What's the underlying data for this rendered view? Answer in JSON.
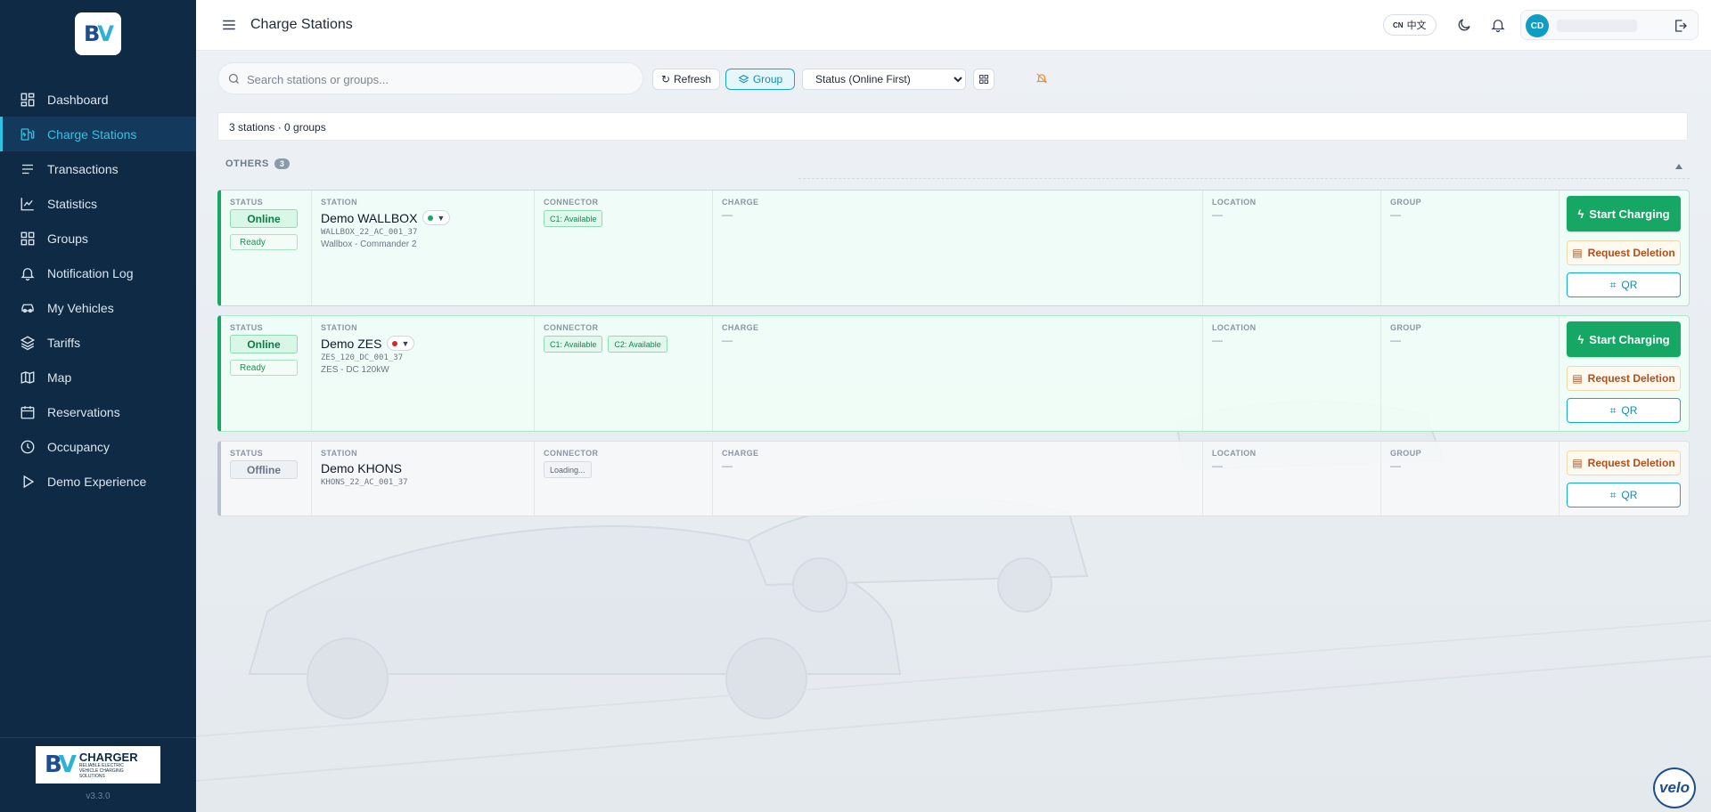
{
  "app": {
    "logo_text": "BV",
    "version": "v3.3.0",
    "brand_title": "CHARGER",
    "brand_subtitle": "RELIABLE ELECTRIC VEHICLE CHARGING SOLUTIONS"
  },
  "sidebar": {
    "items": [
      {
        "label": "Dashboard",
        "icon": "dashboard-icon"
      },
      {
        "label": "Charge Stations",
        "icon": "charger-icon",
        "active": true
      },
      {
        "label": "Transactions",
        "icon": "list-icon"
      },
      {
        "label": "Statistics",
        "icon": "chart-icon"
      },
      {
        "label": "Groups",
        "icon": "grid-icon"
      },
      {
        "label": "Notification Log",
        "icon": "bell-icon"
      },
      {
        "label": "My Vehicles",
        "icon": "car-icon"
      },
      {
        "label": "Tariffs",
        "icon": "layers-icon"
      },
      {
        "label": "Map",
        "icon": "map-icon"
      },
      {
        "label": "Reservations",
        "icon": "calendar-icon"
      },
      {
        "label": "Occupancy",
        "icon": "clock-icon"
      },
      {
        "label": "Demo Experience",
        "icon": "play-icon"
      }
    ]
  },
  "header": {
    "title": "Charge Stations",
    "lang_code": "CN",
    "lang_label": "中文",
    "avatar_initials": "CD"
  },
  "toolbar": {
    "search_placeholder": "Search stations or groups...",
    "refresh_label": "Refresh",
    "group_label": "Group",
    "sort_selected": "Status (Online First)"
  },
  "summary": "3 stations · 0 groups",
  "group": {
    "name": "OTHERS",
    "count": "3"
  },
  "columns": {
    "status": "STATUS",
    "station": "STATION",
    "connector": "CONNECTOR",
    "charge": "CHARGE",
    "location": "LOCATION",
    "group": "GROUP"
  },
  "empty_value": "—",
  "actions": {
    "start": "Start Charging",
    "delete": "Request Deletion",
    "qr": "QR"
  },
  "stations": [
    {
      "status": "Online",
      "readiness": "Ready",
      "name": "Demo WALLBOX",
      "id": "WALLBOX_22_AC_001_37",
      "model": "Wallbox - Commander 2",
      "connectors": [
        "C1: Available"
      ]
    },
    {
      "status": "Online",
      "readiness": "Ready",
      "name": "Demo ZES",
      "id": "ZES_120_DC_001_37",
      "model": "ZES - DC 120kW",
      "connectors": [
        "C1: Available",
        "C2: Available"
      ]
    },
    {
      "status": "Offline",
      "name": "Demo KHONS",
      "id": "KHONS_22_AC_001_37",
      "connectors": [
        "Loading..."
      ]
    }
  ],
  "footer_badge": "velo",
  "colors": {
    "sidebar_bg": "#0f2a44",
    "accent": "#2ec4e6",
    "online_green": "#16a765",
    "warning_orange": "#b24e1c"
  }
}
